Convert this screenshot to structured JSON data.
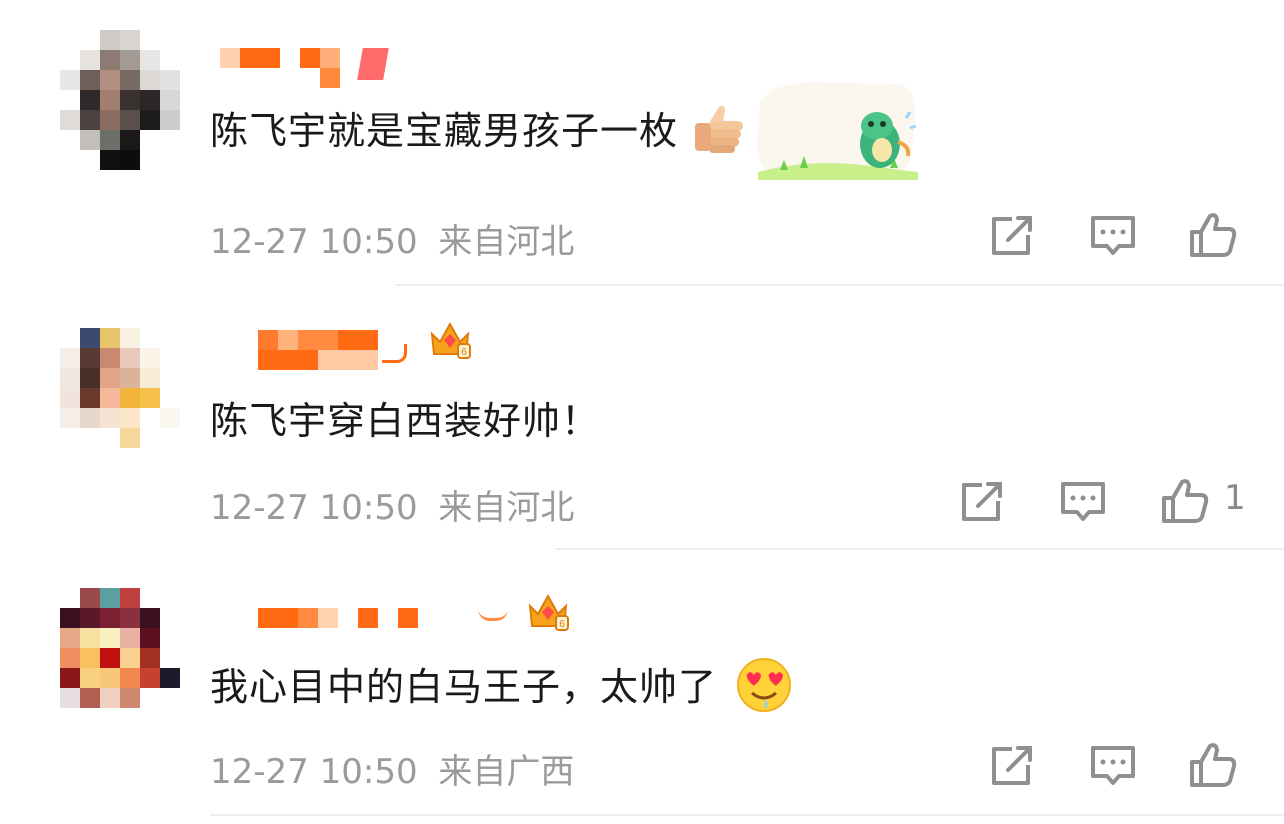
{
  "comments": [
    {
      "text": "陈飞宇就是宝藏男孩子一枚",
      "time": "12-27 10:50",
      "location": "来自河北",
      "likes": "",
      "inline_emoji": "thumbs-up-icon",
      "sticker": "dinosaur-sticker"
    },
    {
      "text": "陈飞宇穿白西装好帅！",
      "time": "12-27 10:50",
      "location": "来自河北",
      "likes": "1",
      "badge": "crown-badge-icon"
    },
    {
      "text": "我心目中的白马王子，太帅了",
      "time": "12-27 10:50",
      "location": "来自广西",
      "likes": "",
      "inline_emoji": "heart-eyes-drool-icon",
      "badge": "crown-badge-icon"
    }
  ],
  "colors": {
    "accent_orange": "#ff6a13",
    "text": "#1a1a1a",
    "meta": "#9a9a9a",
    "icon": "#8f8f8f",
    "divider": "#ededed"
  }
}
